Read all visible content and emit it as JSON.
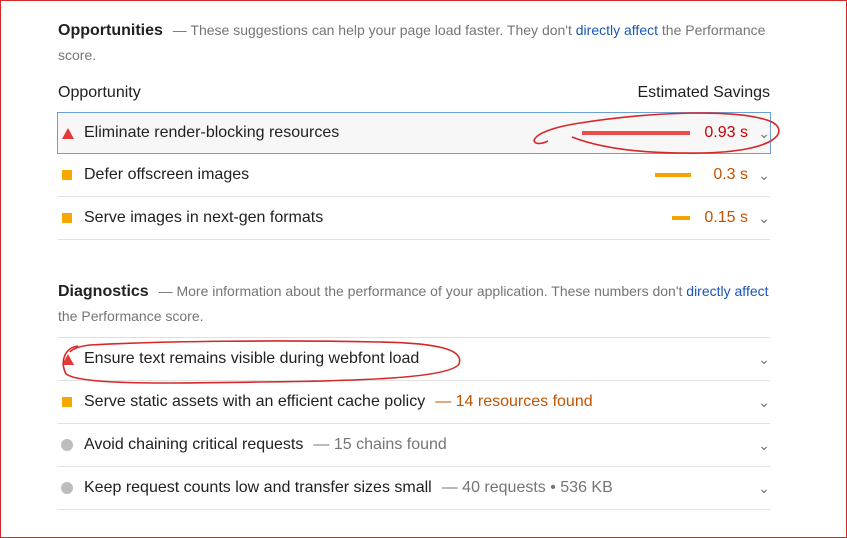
{
  "opportunities": {
    "title": "Opportunities",
    "desc_before": "— These suggestions can help your page load faster. They don't ",
    "desc_link": "directly affect",
    "desc_after": " the Performance score.",
    "col_left": "Opportunity",
    "col_right": "Estimated Savings",
    "items": [
      {
        "title": "Eliminate render-blocking resources",
        "value": "0.93 s",
        "severity": "fail",
        "bar_fraction": 1.0
      },
      {
        "title": "Defer offscreen images",
        "value": "0.3 s",
        "severity": "average",
        "bar_fraction": 0.33
      },
      {
        "title": "Serve images in next-gen formats",
        "value": "0.15 s",
        "severity": "average",
        "bar_fraction": 0.17
      }
    ]
  },
  "diagnostics": {
    "title": "Diagnostics",
    "desc_before": "— More information about the performance of your application. These numbers don't ",
    "desc_link": "directly affect",
    "desc_after": " the Performance score.",
    "items": [
      {
        "title": "Ensure text remains visible during webfont load",
        "display": "",
        "severity": "fail"
      },
      {
        "title": "Serve static assets with an efficient cache policy",
        "display": "— 14 resources found",
        "severity": "average"
      },
      {
        "title": "Avoid chaining critical requests",
        "display": "— 15 chains found",
        "severity": "informative"
      },
      {
        "title": "Keep request counts low and transfer sizes small",
        "display": "— 40 requests • 536 KB",
        "severity": "informative"
      }
    ]
  },
  "icons": {
    "chevron": "chevron-down-icon",
    "fail": "red-triangle-icon",
    "average": "orange-square-icon",
    "informative": "gray-circle-icon"
  },
  "colors": {
    "fail": "#e53935",
    "average": "#f7a800",
    "informative": "#bdbdbd",
    "link": "#1a56b8",
    "annotation": "#d62828"
  }
}
